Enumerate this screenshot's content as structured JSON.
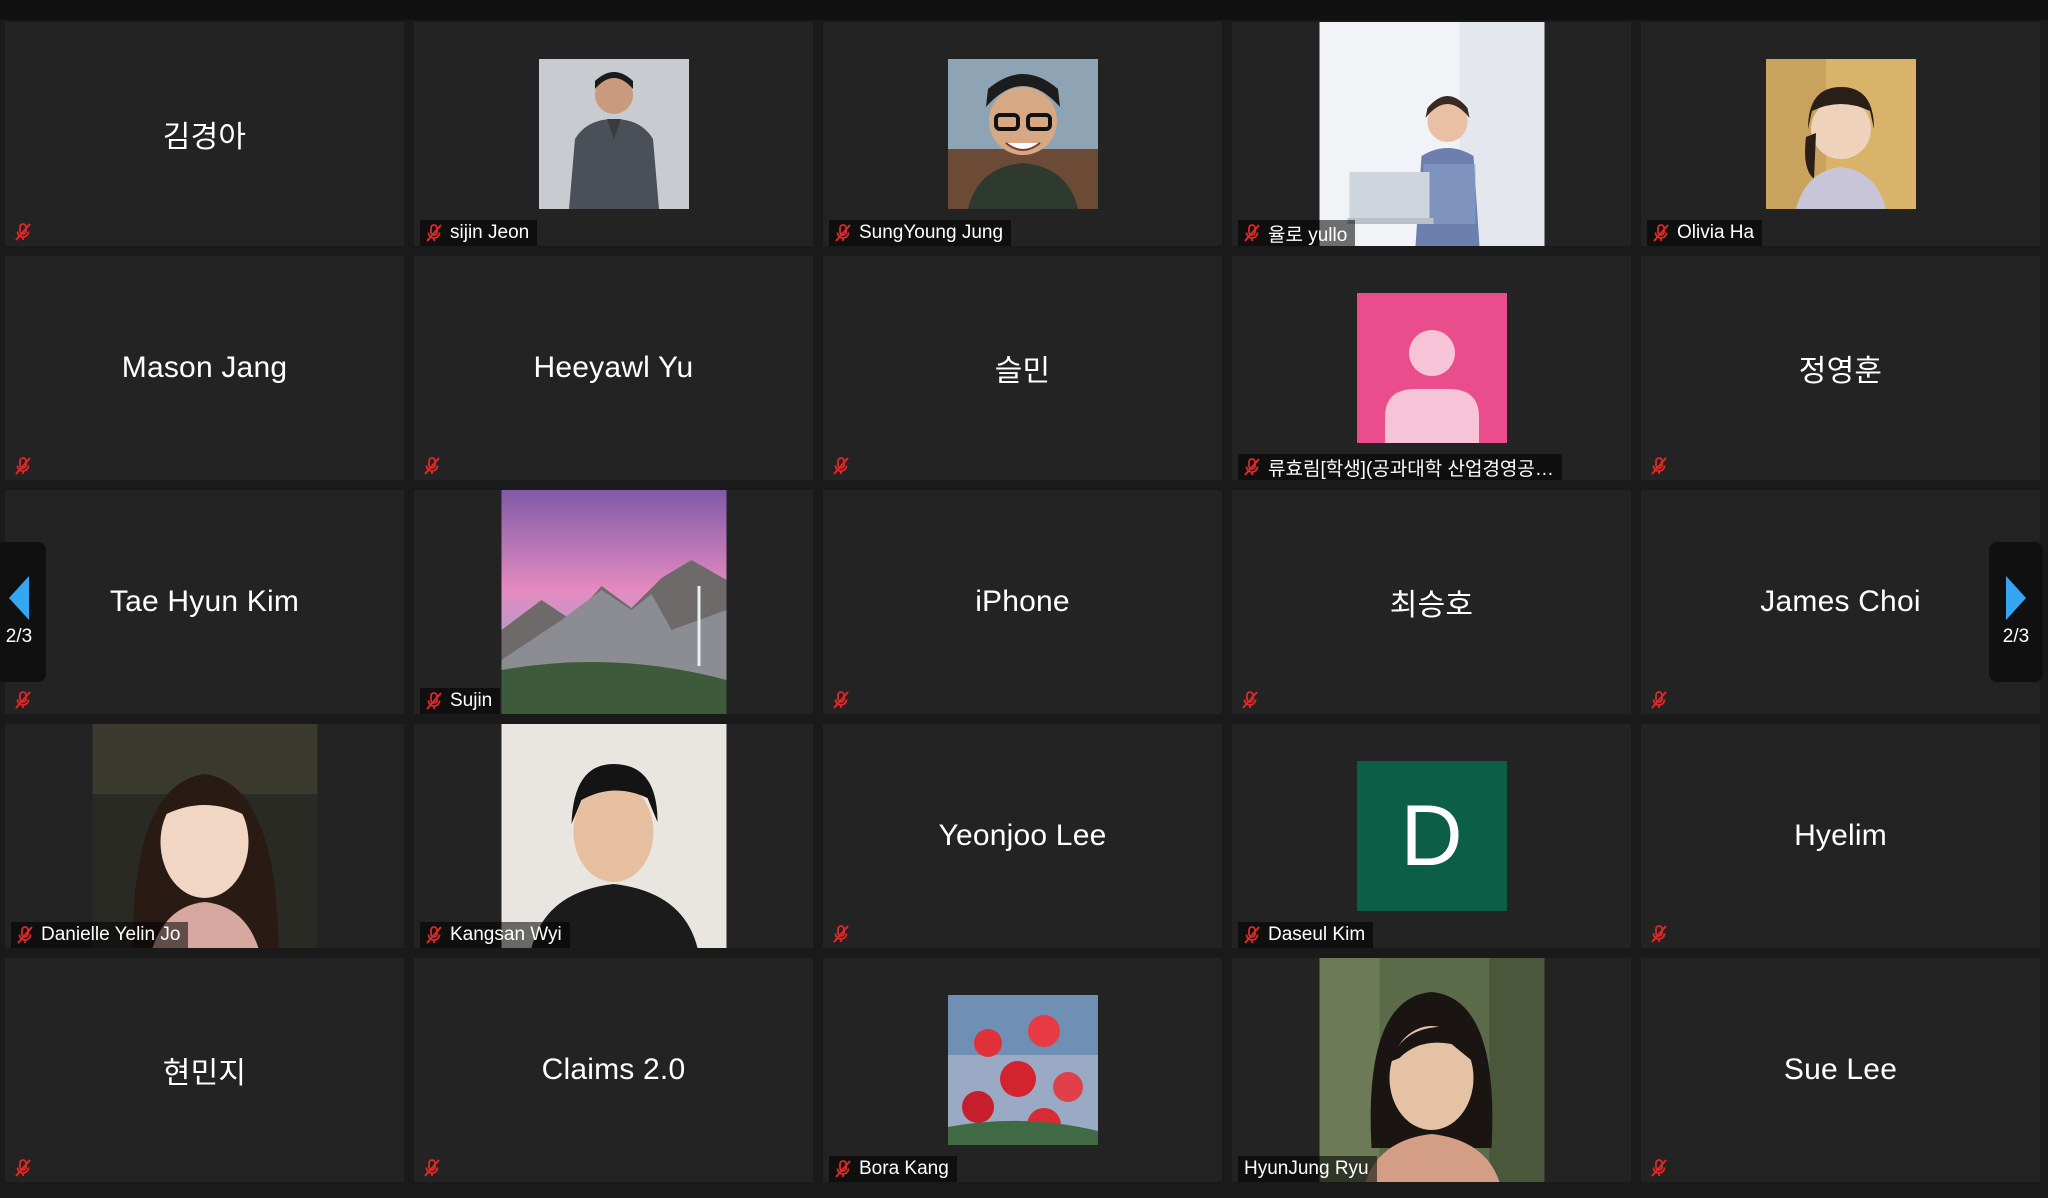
{
  "pagination": {
    "left_label": "2/3",
    "right_label": "2/3"
  },
  "colors": {
    "muted_icon": "#e02828",
    "pager_arrow": "#35a7f2",
    "tile_bg": "#232323"
  },
  "participants": [
    {
      "display": "김경아",
      "label": "",
      "video": false
    },
    {
      "display": "",
      "label": "sijin Jeon",
      "video": true
    },
    {
      "display": "",
      "label": "SungYoung Jung",
      "video": true
    },
    {
      "display": "",
      "label": "율로 yullo",
      "video": true
    },
    {
      "display": "",
      "label": "Olivia Ha",
      "video": true
    },
    {
      "display": "Mason Jang",
      "label": "",
      "video": false
    },
    {
      "display": "Heeyawl Yu",
      "label": "",
      "video": false
    },
    {
      "display": "슬민",
      "label": "",
      "video": false
    },
    {
      "display": "",
      "label": "류효림[학생](공과대학 산업경영공…",
      "video": false
    },
    {
      "display": "정영훈",
      "label": "",
      "video": false
    },
    {
      "display": "Tae Hyun Kim",
      "label": "",
      "video": false
    },
    {
      "display": "",
      "label": "Sujin",
      "video": true
    },
    {
      "display": "iPhone",
      "label": "",
      "video": false
    },
    {
      "display": "최승호",
      "label": "",
      "video": false
    },
    {
      "display": "James Choi",
      "label": "",
      "video": false
    },
    {
      "display": "",
      "label": "Danielle Yelin Jo",
      "video": true
    },
    {
      "display": "",
      "label": "Kangsan Wyi",
      "video": true
    },
    {
      "display": "Yeonjoo Lee",
      "label": "",
      "video": false
    },
    {
      "display": "",
      "label": "Daseul Kim",
      "video": false,
      "avatar_letter": "D"
    },
    {
      "display": "Hyelim",
      "label": "",
      "video": false
    },
    {
      "display": "현민지",
      "label": "",
      "video": false
    },
    {
      "display": "Claims 2.0",
      "label": "",
      "video": false
    },
    {
      "display": "",
      "label": "Bora Kang",
      "video": true
    },
    {
      "display": "",
      "label": "HyunJung Ryu",
      "video": true
    },
    {
      "display": "Sue Lee",
      "label": "",
      "video": false
    }
  ]
}
